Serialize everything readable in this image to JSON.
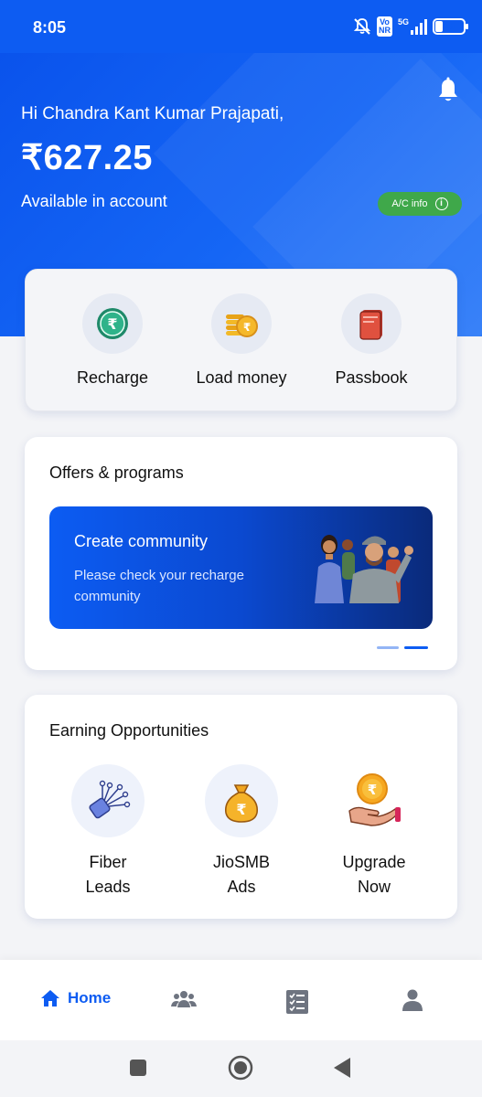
{
  "status_bar": {
    "time": "8:05",
    "vo_nr": [
      "Vo",
      "NR"
    ],
    "network": "5G",
    "battery": "25"
  },
  "header": {
    "greeting": "Hi Chandra Kant Kumar Prajapati,",
    "balance": "₹627.25",
    "balance_caption": "Available in account",
    "ac_info_label": "A/C info"
  },
  "quick_actions": [
    {
      "label": "Recharge",
      "icon": "rupee-coin-icon"
    },
    {
      "label": "Load money",
      "icon": "coins-stack-icon"
    },
    {
      "label": "Passbook",
      "icon": "passbook-icon"
    }
  ],
  "offers": {
    "title": "Offers & programs",
    "banner": {
      "title": "Create community",
      "subtitle": "Please check your recharge community"
    },
    "carousel_pages": 2,
    "active_page": 2
  },
  "earning": {
    "title": "Earning Opportunities",
    "items": [
      {
        "line1": "Fiber",
        "line2": "Leads",
        "icon": "fiber-cable-icon"
      },
      {
        "line1": "JioSMB",
        "line2": "Ads",
        "icon": "money-bag-icon"
      },
      {
        "line1": "Upgrade",
        "line2": "Now",
        "icon": "hand-rupee-icon"
      }
    ]
  },
  "bottom_nav": {
    "home_label": "Home",
    "active": "Home",
    "icons": [
      "home-icon",
      "community-icon",
      "checklist-icon",
      "profile-icon"
    ]
  },
  "colors": {
    "brand_blue": "#0d5cf2",
    "ac_info_green": "#3fa84a"
  }
}
